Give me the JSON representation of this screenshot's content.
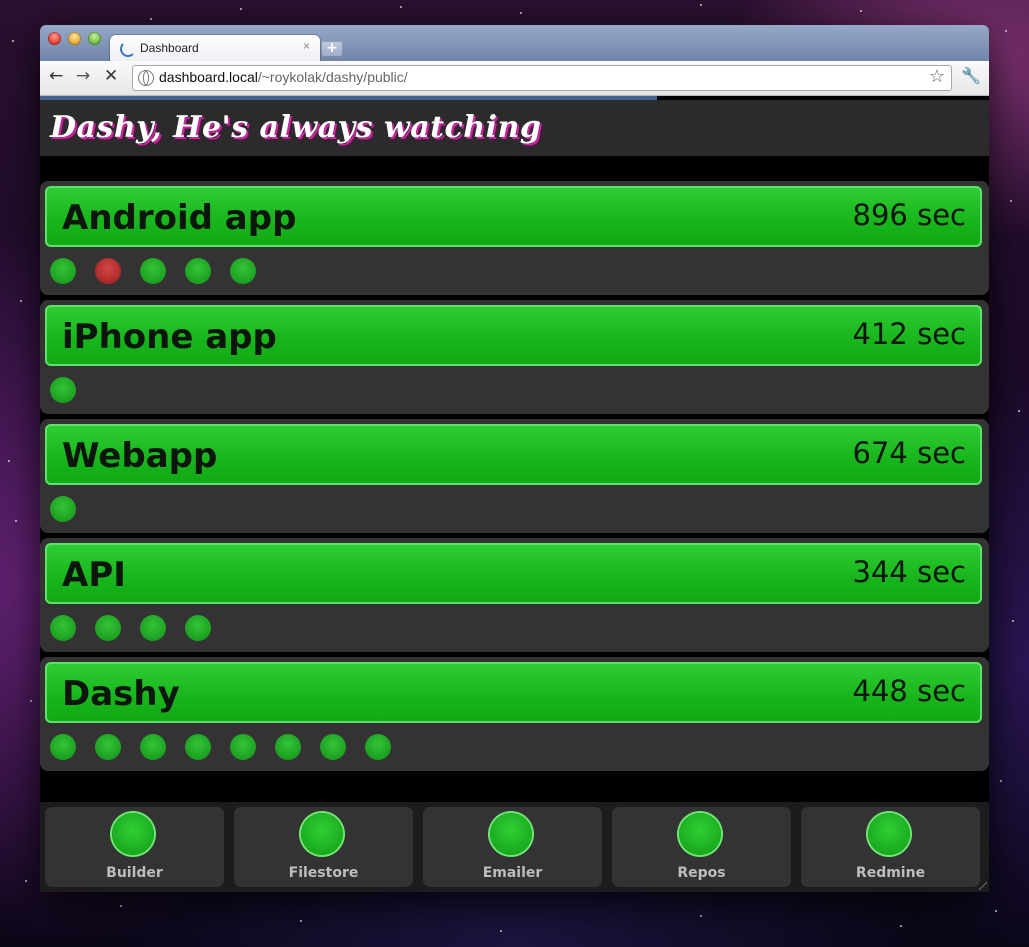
{
  "browser": {
    "tab_title": "Dashboard",
    "tab_close": "×",
    "new_tab": "+",
    "url_host": "dashboard.local",
    "url_path": "/~roykolak/dashy/public/",
    "load_progress": 0.65
  },
  "header": {
    "title": "Dashy, He's always watching"
  },
  "colors": {
    "success": "#1ab51e",
    "failure": "#b02c2c",
    "panel": "#333333",
    "background": "#000000"
  },
  "projects": [
    {
      "name": "Android app",
      "time": "896 sec",
      "builds": [
        "pass",
        "fail",
        "pass",
        "pass",
        "pass"
      ]
    },
    {
      "name": "iPhone app",
      "time": "412 sec",
      "builds": [
        "pass"
      ]
    },
    {
      "name": "Webapp",
      "time": "674 sec",
      "builds": [
        "pass"
      ]
    },
    {
      "name": "API",
      "time": "344 sec",
      "builds": [
        "pass",
        "pass",
        "pass",
        "pass"
      ]
    },
    {
      "name": "Dashy",
      "time": "448 sec",
      "builds": [
        "pass",
        "pass",
        "pass",
        "pass",
        "pass",
        "pass",
        "pass",
        "pass"
      ]
    }
  ],
  "services": [
    {
      "label": "Builder",
      "status": "up"
    },
    {
      "label": "Filestore",
      "status": "up"
    },
    {
      "label": "Emailer",
      "status": "up"
    },
    {
      "label": "Repos",
      "status": "up"
    },
    {
      "label": "Redmine",
      "status": "up"
    }
  ]
}
